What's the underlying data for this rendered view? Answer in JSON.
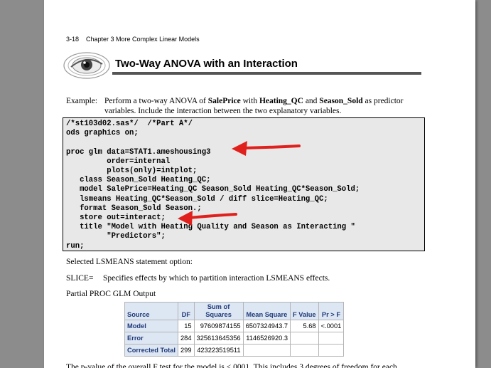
{
  "header": {
    "page_ref": "3-18",
    "chapter": "Chapter 3  More Complex Linear Models"
  },
  "section_title": "Two-Way ANOVA with an Interaction",
  "example": {
    "label": "Example:",
    "line1_prefix": "Perform a two-way ANOVA of ",
    "line1_var1": "SalePrice",
    "line1_mid1": " with ",
    "line1_var2": "Heating_QC",
    "line1_mid2": " and ",
    "line1_var3": "Season_Sold",
    "line1_suffix": " as predictor",
    "line2": "variables. Include the interaction between the two explanatory variables."
  },
  "code": {
    "lines": [
      "/*st103d02.sas*/  /*Part A*/",
      "ods graphics on;",
      "",
      "proc glm data=STAT1.ameshousing3",
      "         order=internal",
      "         plots(only)=intplot;",
      "   class Season_Sold Heating_QC;",
      "   model SalePrice=Heating_QC Season_Sold Heating_QC*Season_Sold;",
      "   lsmeans Heating_QC*Season_Sold / diff slice=Heating_QC;",
      "   format Season_Sold Season.;",
      "   store out=interact;",
      "   title \"Model with Heating Quality and Season as Interacting \"",
      "         \"Predictors\";",
      "run;"
    ]
  },
  "option_heading": "Selected LSMEANS statement option:",
  "slice": {
    "key": "SLICE=",
    "desc": "Specifies effects by which to partition interaction LSMEANS effects."
  },
  "partial_heading": "Partial PROC GLM Output",
  "anova": {
    "headers": {
      "source": "Source",
      "df": "DF",
      "ss": "Sum of Squares",
      "ms": "Mean Square",
      "f": "F Value",
      "p": "Pr > F"
    },
    "rows": [
      {
        "source": "Model",
        "df": "15",
        "ss": "97609874155",
        "ms": "6507324943.7",
        "f": "5.68",
        "p": "<.0001"
      },
      {
        "source": "Error",
        "df": "284",
        "ss": "325613645356",
        "ms": "1146526920.3",
        "f": "",
        "p": ""
      },
      {
        "source": "Corrected Total",
        "df": "299",
        "ss": "423223519511",
        "ms": "",
        "f": "",
        "p": ""
      }
    ]
  },
  "cutoff_text": "The p-value of the overall F test for the model is <.0001. This includes 3 degrees of freedom for each",
  "colors": {
    "arrow": "#e0201c",
    "table_header_bg": "#dde6f3",
    "table_header_text": "#1f3a78",
    "code_bg": "#e8e8e8"
  }
}
